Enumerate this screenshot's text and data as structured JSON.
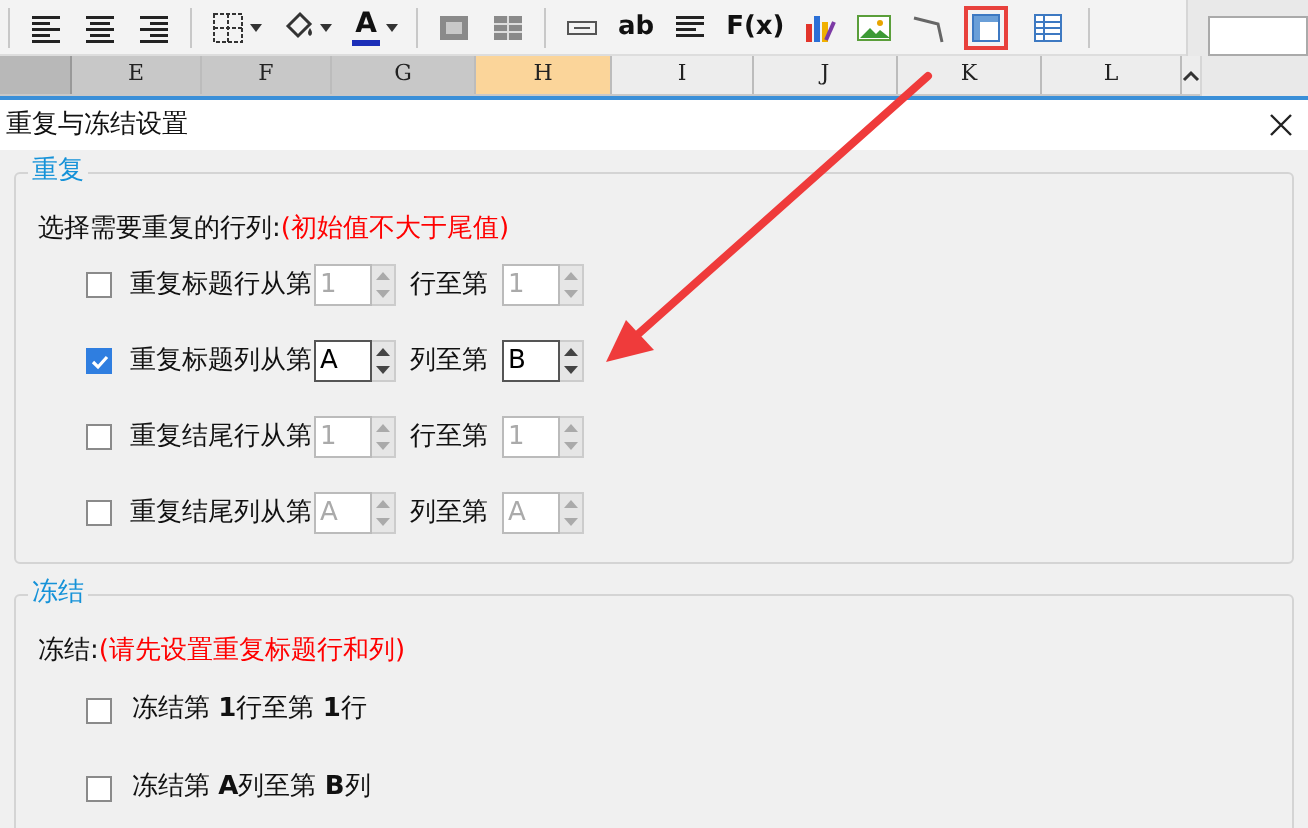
{
  "toolbar": [
    {
      "kind": "align-left"
    },
    {
      "kind": "align-center"
    },
    {
      "kind": "align-right"
    },
    {
      "kind": "borders"
    },
    {
      "kind": "fill"
    },
    {
      "kind": "font-color",
      "label": "A"
    },
    {
      "kind": "merge"
    },
    {
      "kind": "unmerge"
    },
    {
      "kind": "input"
    },
    {
      "kind": "text",
      "label": "ab"
    },
    {
      "kind": "lines"
    },
    {
      "kind": "text",
      "label": "F(x)"
    },
    {
      "kind": "chart"
    },
    {
      "kind": "image"
    },
    {
      "kind": "line"
    },
    {
      "kind": "freeze",
      "highlighted": true
    },
    {
      "kind": "table",
      "highlighted": false
    }
  ],
  "columns": [
    {
      "label": "E",
      "selected": false
    },
    {
      "label": "F",
      "selected": false
    },
    {
      "label": "G",
      "selected": false
    },
    {
      "label": "H",
      "selected": true
    },
    {
      "label": "I",
      "selected": false
    },
    {
      "label": "J",
      "selected": false
    },
    {
      "label": "K",
      "selected": false
    },
    {
      "label": "L",
      "selected": false
    }
  ],
  "dialog": {
    "title": "重复与冻结设置",
    "repeat": {
      "legend": "重复",
      "prompt": "选择需要重复的行列:",
      "note": "(初始值不大于尾值)",
      "rows": [
        {
          "checked": false,
          "label": "重复标题行从第",
          "from": "1",
          "middle": "行至第",
          "to": "1"
        },
        {
          "checked": true,
          "label": "重复标题列从第",
          "from": "A",
          "middle": "列至第",
          "to": "B"
        },
        {
          "checked": false,
          "label": "重复结尾行从第",
          "from": "1",
          "middle": "行至第",
          "to": "1"
        },
        {
          "checked": false,
          "label": "重复结尾列从第",
          "from": "A",
          "middle": "列至第",
          "to": "A"
        }
      ]
    },
    "freeze": {
      "legend": "冻结",
      "prompt": "冻结:",
      "note": "(请先设置重复标题行和列)",
      "rows": [
        {
          "checked": false,
          "label": "冻结第 **1**行至第 **1**行"
        },
        {
          "checked": false,
          "label": "冻结第 **A**列至第 **B**列"
        }
      ]
    }
  }
}
